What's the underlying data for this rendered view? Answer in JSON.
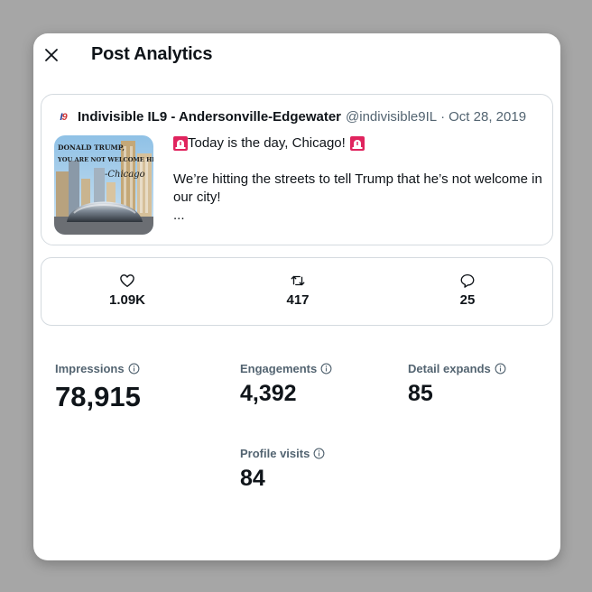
{
  "header": {
    "title": "Post Analytics",
    "close_icon": "close-icon"
  },
  "tweet": {
    "author": "Indivisible IL9 - Andersonville-Edgewater",
    "handle": "@indivisible9IL",
    "separator": "·",
    "date": "Oct 28, 2019",
    "line1": "Today is the day, Chicago!",
    "body": "We’re hitting the streets to tell Trump that he’s not welcome in our city!",
    "ellipsis": "...",
    "thumbnail": {
      "line1": "DONALD TRUMP,",
      "line2": "YOU ARE NOT WELCOME HERE!",
      "line3": "-Chicago"
    }
  },
  "engagement": {
    "likes": "1.09K",
    "reposts": "417",
    "replies": "25"
  },
  "metrics": {
    "impressions_label": "Impressions",
    "impressions": "78,915",
    "engagements_label": "Engagements",
    "engagements": "4,392",
    "detail_expands_label": "Detail expands",
    "detail_expands": "85",
    "profile_visits_label": "Profile visits",
    "profile_visits": "84"
  },
  "colors": {
    "text": "#0f1419",
    "secondary": "#536471",
    "border": "#d4dadf",
    "backdrop": "#a6a6a6"
  }
}
